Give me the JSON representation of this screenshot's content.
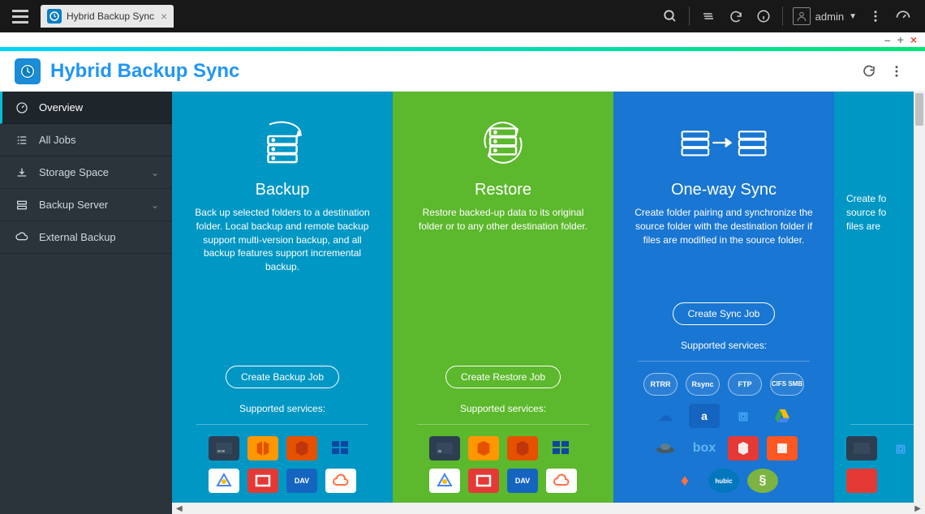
{
  "topbar": {
    "tab_label": "Hybrid Backup Sync",
    "user_label": "admin"
  },
  "app": {
    "title": "Hybrid Backup Sync"
  },
  "sidebar": {
    "items": [
      {
        "label": "Overview"
      },
      {
        "label": "All Jobs"
      },
      {
        "label": "Storage Space"
      },
      {
        "label": "Backup Server"
      },
      {
        "label": "External Backup"
      }
    ]
  },
  "cards": {
    "backup": {
      "title": "Backup",
      "desc": "Back up selected folders to a destination folder. Local backup and remote backup support multi-version backup, and all backup features support incremental backup.",
      "button": "Create Backup Job",
      "supported": "Supported services:"
    },
    "restore": {
      "title": "Restore",
      "desc": "Restore backed-up data to its original folder or to any other destination folder.",
      "button": "Create Restore Job",
      "supported": "Supported services:"
    },
    "sync": {
      "title": "One-way Sync",
      "desc": "Create folder pairing and synchronize the source folder with the destination folder if files are modified in the source folder.",
      "button": "Create Sync Job",
      "supported": "Supported services:",
      "pills": [
        "RTRR",
        "Rsync",
        "FTP",
        "CIFS SMB"
      ]
    },
    "extra": {
      "desc_part": "Create fo\nsource fo\nfiles are"
    }
  },
  "labels": {
    "box": "box",
    "dav": "DAV",
    "azure": "Azure",
    "hubic": "hubic"
  }
}
